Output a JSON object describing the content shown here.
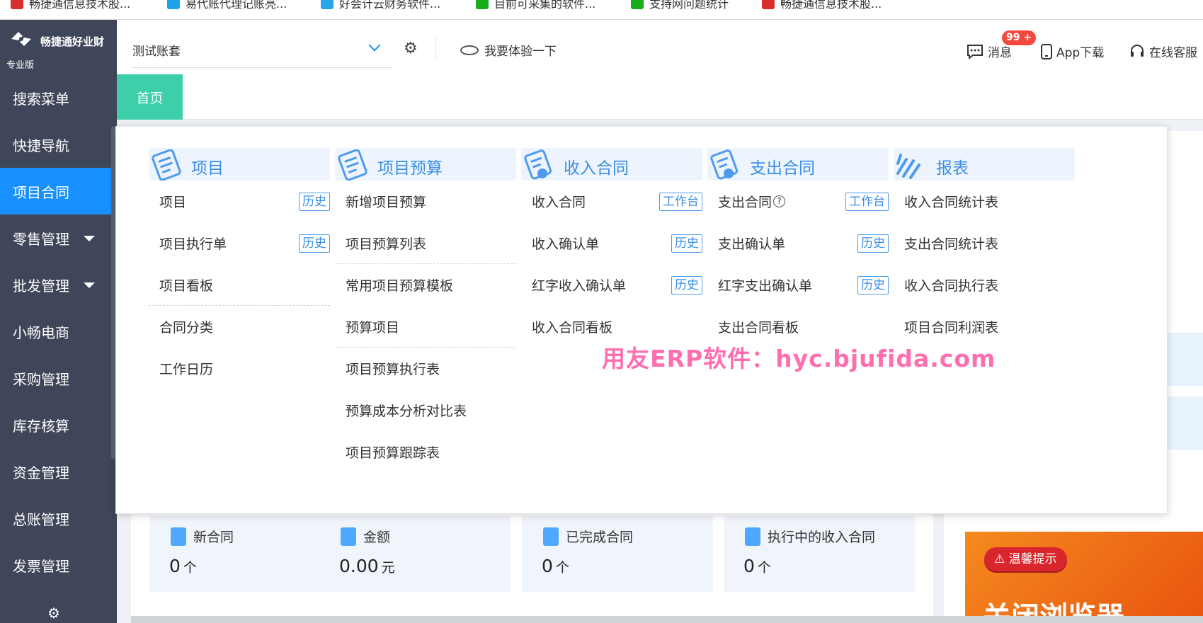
{
  "bookmarks": [
    {
      "label": "畅捷通信息技术股...",
      "color": "#d72e2e"
    },
    {
      "label": "易代账代理记账亮...",
      "color": "#1aa3e8"
    },
    {
      "label": "好会计云财务软件...",
      "color": "#2ba5e9"
    },
    {
      "label": "目前可采集的软件...",
      "color": "#1aad19"
    },
    {
      "label": "支持网问题统计",
      "color": "#1aad19"
    },
    {
      "label": "畅捷通信息技术股...",
      "color": "#d72e2e"
    }
  ],
  "sidebar": {
    "brand": "畅捷通好业财",
    "edition": "专业版",
    "items": [
      {
        "label": "搜索菜单"
      },
      {
        "label": "快捷导航"
      },
      {
        "label": "项目合同"
      },
      {
        "label": "零售管理"
      },
      {
        "label": "批发管理"
      },
      {
        "label": "小畅电商"
      },
      {
        "label": "采购管理"
      },
      {
        "label": "库存核算"
      },
      {
        "label": "资金管理"
      },
      {
        "label": "总账管理"
      },
      {
        "label": "发票管理"
      }
    ]
  },
  "header": {
    "account": "测试账套",
    "try_label": "我要体验一下",
    "messages_label": "消息",
    "messages_badge": "99 +",
    "app_label": "App下载",
    "service_label": "在线客服"
  },
  "tabs": {
    "home": "首页"
  },
  "menu": {
    "columns": [
      {
        "title": "项目",
        "items": [
          {
            "label": "项目",
            "tag": "历史"
          },
          {
            "label": "项目执行单",
            "tag": "历史"
          },
          {
            "label": "项目看板"
          },
          {
            "label": "合同分类"
          },
          {
            "label": "工作日历"
          }
        ]
      },
      {
        "title": "项目预算",
        "items": [
          {
            "label": "新增项目预算"
          },
          {
            "label": "项目预算列表"
          },
          {
            "label": "常用项目预算模板"
          },
          {
            "label": "预算项目"
          },
          {
            "label": "项目预算执行表"
          },
          {
            "label": "预算成本分析对比表"
          },
          {
            "label": "项目预算跟踪表"
          }
        ]
      },
      {
        "title": "收入合同",
        "items": [
          {
            "label": "收入合同",
            "tag": "工作台"
          },
          {
            "label": "收入确认单",
            "tag": "历史"
          },
          {
            "label": "红字收入确认单",
            "tag": "历史"
          },
          {
            "label": "收入合同看板"
          }
        ]
      },
      {
        "title": "支出合同",
        "items": [
          {
            "label": "支出合同",
            "tag": "工作台",
            "help": "?"
          },
          {
            "label": "支出确认单",
            "tag": "历史"
          },
          {
            "label": "红字支出确认单",
            "tag": "历史"
          },
          {
            "label": "支出合同看板"
          }
        ]
      },
      {
        "title": "报表",
        "items": [
          {
            "label": "收入合同统计表"
          },
          {
            "label": "支出合同统计表"
          },
          {
            "label": "收入合同执行表"
          },
          {
            "label": "项目合同利润表"
          }
        ]
      }
    ]
  },
  "dashboard": {
    "stats": [
      {
        "label": "新合同",
        "value": "0",
        "unit": "个"
      },
      {
        "label": "金额",
        "value": "0.00",
        "unit": "元"
      },
      {
        "label": "已完成合同",
        "value": "0",
        "unit": "个"
      },
      {
        "label": "执行中的收入合同",
        "value": "0",
        "unit": "个"
      }
    ],
    "promo_tip": "温馨提示",
    "promo_text": "关闭浏览器"
  },
  "watermark": "用友ERP软件：hyc.bjufida.com",
  "colors": {
    "sidebar": "#3f4659",
    "active": "#1890ff",
    "home_tab": "#3ccfaa",
    "menu_accent": "#3a8ee6"
  }
}
